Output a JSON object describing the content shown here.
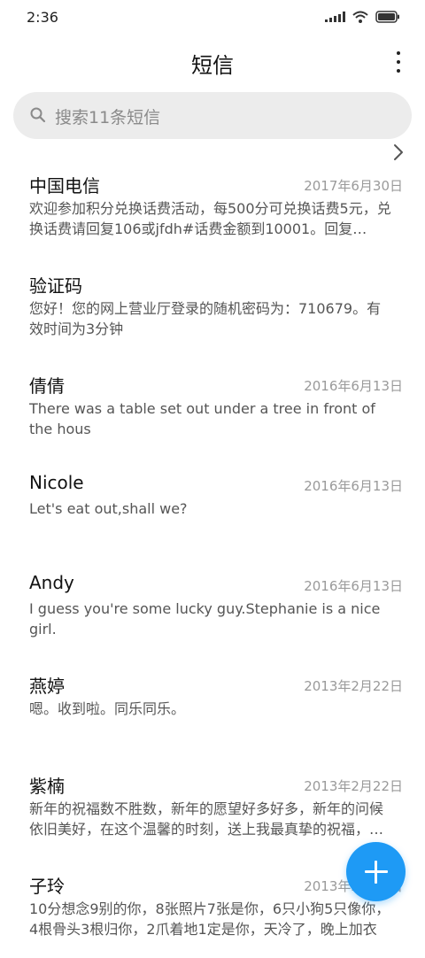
{
  "status_bar": {
    "time": "2:36"
  },
  "header": {
    "title": "短信"
  },
  "search": {
    "placeholder": "搜索11条短信"
  },
  "messages": [
    {
      "sender": "中国电信",
      "date": "2017年6月30日",
      "preview": "欢迎参加积分兑换话费活动，每500分可兑换话费5元，兑换话费请回复106或jfdh#话费金额到10001。回复…"
    },
    {
      "sender": "验证码",
      "date": "",
      "preview": "您好！您的网上营业厅登录的随机密码为：710679。有效时间为3分钟"
    },
    {
      "sender": "倩倩",
      "date": "2016年6月13日",
      "preview": "There was a table set out under a tree in front of the hous"
    },
    {
      "sender": "Nicole",
      "date": "2016年6月13日",
      "preview": "Let's eat out,shall we?"
    },
    {
      "sender": "Andy",
      "date": "2016年6月13日",
      "preview": "I guess you're some lucky guy.Stephanie is a nice girl."
    },
    {
      "sender": "燕婷",
      "date": "2013年2月22日",
      "preview": "嗯。收到啦。同乐同乐。"
    },
    {
      "sender": "紫楠",
      "date": "2013年2月22日",
      "preview": "新年的祝福数不胜数，新年的愿望好多好多，新年的问候依旧美好，在这个温馨的时刻，送上我最真挚的祝福，…"
    },
    {
      "sender": "子玲",
      "date": "2013年2月22日",
      "preview": "10分想念9别的你，8张照片7张是你，6只小狗5只像你，4根骨头3根归你，2爪着地1定是你，天冷了，晚上加衣"
    }
  ],
  "icons": {
    "search": "search-icon",
    "more": "more-vertical-icon",
    "chevron": "chevron-right-icon",
    "compose": "plus-icon"
  },
  "colors": {
    "accent": "#1e9af5",
    "search_bg": "#ececec"
  }
}
